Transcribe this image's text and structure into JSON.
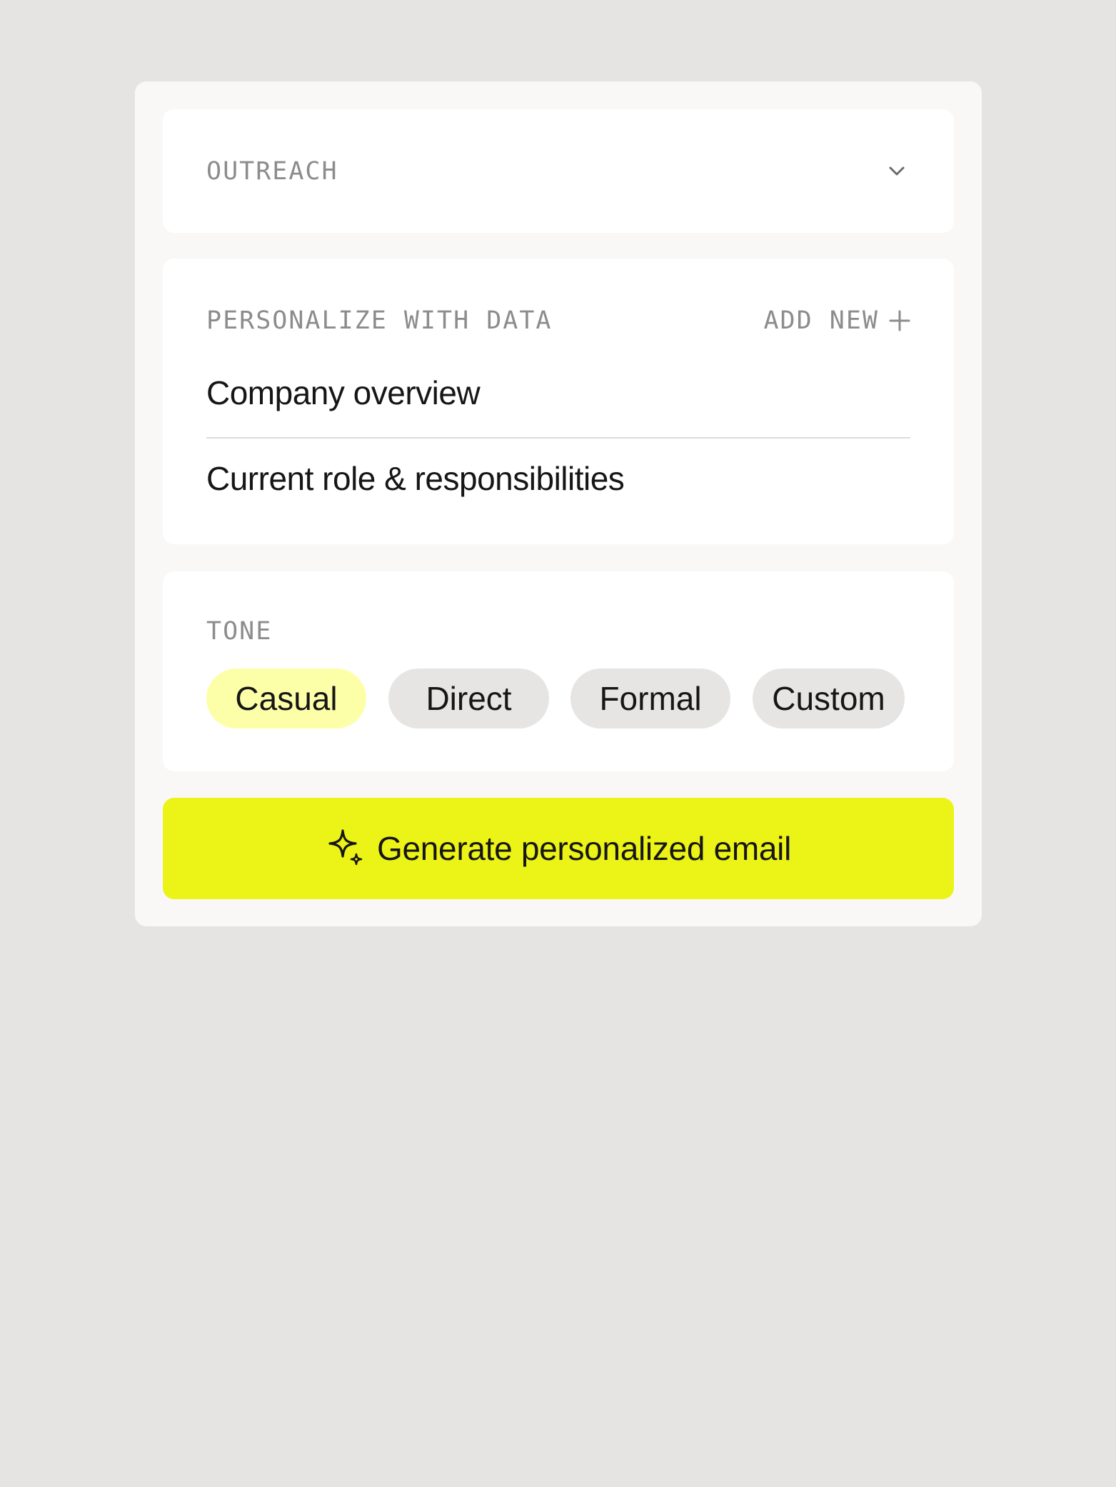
{
  "template_select": {
    "label": "OUTREACH",
    "icon": "chevron-down-icon"
  },
  "personalize": {
    "title": "PERSONALIZE WITH DATA",
    "add_new_label": "ADD NEW",
    "add_icon": "plus-icon",
    "items": [
      {
        "label": "Company overview"
      },
      {
        "label": "Current role & responsibilities"
      }
    ]
  },
  "tone": {
    "title": "TONE",
    "selected": "Casual",
    "options": [
      {
        "label": "Casual"
      },
      {
        "label": "Direct"
      },
      {
        "label": "Formal"
      },
      {
        "label": "Custom"
      }
    ]
  },
  "generate_button": {
    "label": "Generate personalized email",
    "icon": "sparkle-icon"
  },
  "colors": {
    "page_bg": "#e5e4e2",
    "panel_bg": "#f9f8f6",
    "card_bg": "#ffffff",
    "accent": "#ecf316",
    "selected_pill": "#fdffa8",
    "pill": "#e6e5e3",
    "muted_text": "#8c8c8c",
    "text": "#161616"
  }
}
